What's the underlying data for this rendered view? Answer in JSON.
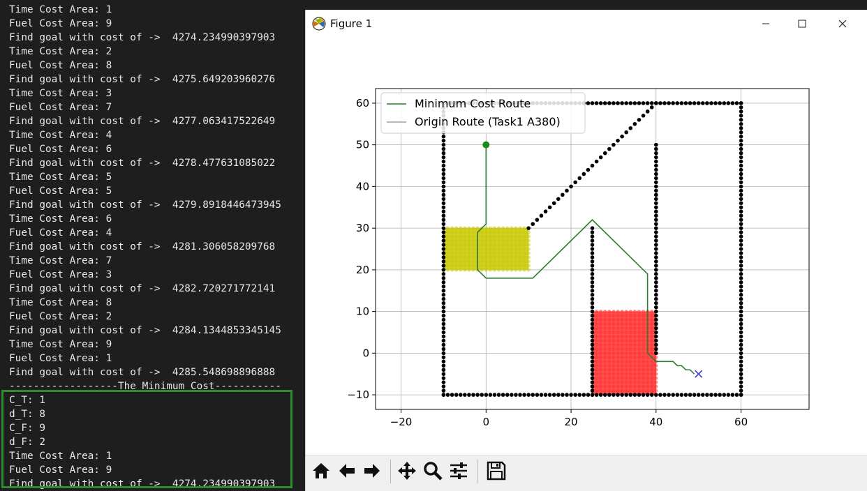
{
  "terminal": {
    "lines": [
      "Time Cost Area: 1",
      "Fuel Cost Area: 9",
      "Find goal with cost of ->  4274.234990397903",
      "Time Cost Area: 2",
      "Fuel Cost Area: 8",
      "Find goal with cost of ->  4275.649203960276",
      "Time Cost Area: 3",
      "Fuel Cost Area: 7",
      "Find goal with cost of ->  4277.063417522649",
      "Time Cost Area: 4",
      "Fuel Cost Area: 6",
      "Find goal with cost of ->  4278.477631085022",
      "Time Cost Area: 5",
      "Fuel Cost Area: 5",
      "Find goal with cost of ->  4279.8918446473945",
      "Time Cost Area: 6",
      "Fuel Cost Area: 4",
      "Find goal with cost of ->  4281.306058209768",
      "Time Cost Area: 7",
      "Fuel Cost Area: 3",
      "Find goal with cost of ->  4282.720271772141",
      "Time Cost Area: 8",
      "Fuel Cost Area: 2",
      "Find goal with cost of ->  4284.1344853345145",
      "Time Cost Area: 9",
      "Fuel Cost Area: 1",
      "Find goal with cost of ->  4285.548698896888",
      "------------------The Minimum Cost-----------"
    ],
    "result_lines": [
      "C_T: 1",
      "d_T: 8",
      "C_F: 9",
      "d_F: 2",
      "Time Cost Area: 1",
      "Fuel Cost Area: 9",
      "Find goal with cost of ->  4274.234990397903"
    ],
    "highlight_color": "#2e8b2e"
  },
  "window": {
    "title": "Figure 1",
    "minimize_icon": "minimize-icon",
    "maximize_icon": "maximize-icon",
    "close_icon": "close-icon"
  },
  "toolbar": {
    "buttons": [
      "home-icon",
      "back-arrow-icon",
      "forward-arrow-icon",
      "pan-move-icon",
      "zoom-magnifier-icon",
      "subplots-config-icon",
      "save-floppy-icon"
    ]
  },
  "chart_data": {
    "type": "scatter",
    "xlim": [
      -26,
      76
    ],
    "ylim": [
      -13.5,
      63.5
    ],
    "xticks": [
      -20,
      0,
      20,
      40,
      60
    ],
    "yticks": [
      -10,
      0,
      10,
      20,
      30,
      40,
      50,
      60
    ],
    "grid": true,
    "legend_position": "top-left",
    "legend": [
      "Minimum Cost Route",
      "Origin Route (Task1 A380)"
    ],
    "series": [
      {
        "name": "Minimum Cost Route",
        "kind": "line",
        "color": "#2f7a2f",
        "x": [
          0,
          0,
          -2,
          -2,
          0,
          11,
          25,
          38,
          38,
          40,
          44,
          45,
          46,
          47,
          48,
          49
        ],
        "y": [
          50,
          31,
          29,
          20,
          18,
          18,
          32,
          19,
          0,
          -2,
          -2,
          -3,
          -3,
          -4,
          -4,
          -5
        ]
      },
      {
        "name": "Origin Route (Task1 A380)",
        "kind": "line",
        "color": "#b8b8b8",
        "x": [
          -10,
          60
        ],
        "y": [
          60,
          60
        ]
      }
    ],
    "obstacles": {
      "color": "#000000",
      "segments": [
        {
          "x1": -10,
          "y1": -10,
          "x2": 60,
          "y2": -10
        },
        {
          "x1": -10,
          "y1": -10,
          "x2": -10,
          "y2": 60
        },
        {
          "x1": -10,
          "y1": 60,
          "x2": 60,
          "y2": 60
        },
        {
          "x1": 60,
          "y1": -10,
          "x2": 60,
          "y2": 60
        },
        {
          "x1": 10,
          "y1": 30,
          "x2": 40,
          "y2": 60
        },
        {
          "x1": 25,
          "y1": -10,
          "x2": 25,
          "y2": 30
        },
        {
          "x1": 40,
          "y1": 0,
          "x2": 40,
          "y2": 50
        }
      ]
    },
    "areas": [
      {
        "color": "#c8c800",
        "x": [
          -10,
          10
        ],
        "y": [
          20,
          30
        ]
      },
      {
        "color": "#ff3030",
        "x": [
          25,
          40
        ],
        "y": [
          -10,
          10
        ]
      }
    ],
    "start": {
      "x": 0,
      "y": 50,
      "color": "#1a8a1a"
    },
    "goal": {
      "x": 50,
      "y": -5,
      "color": "#3a3ad0"
    }
  }
}
